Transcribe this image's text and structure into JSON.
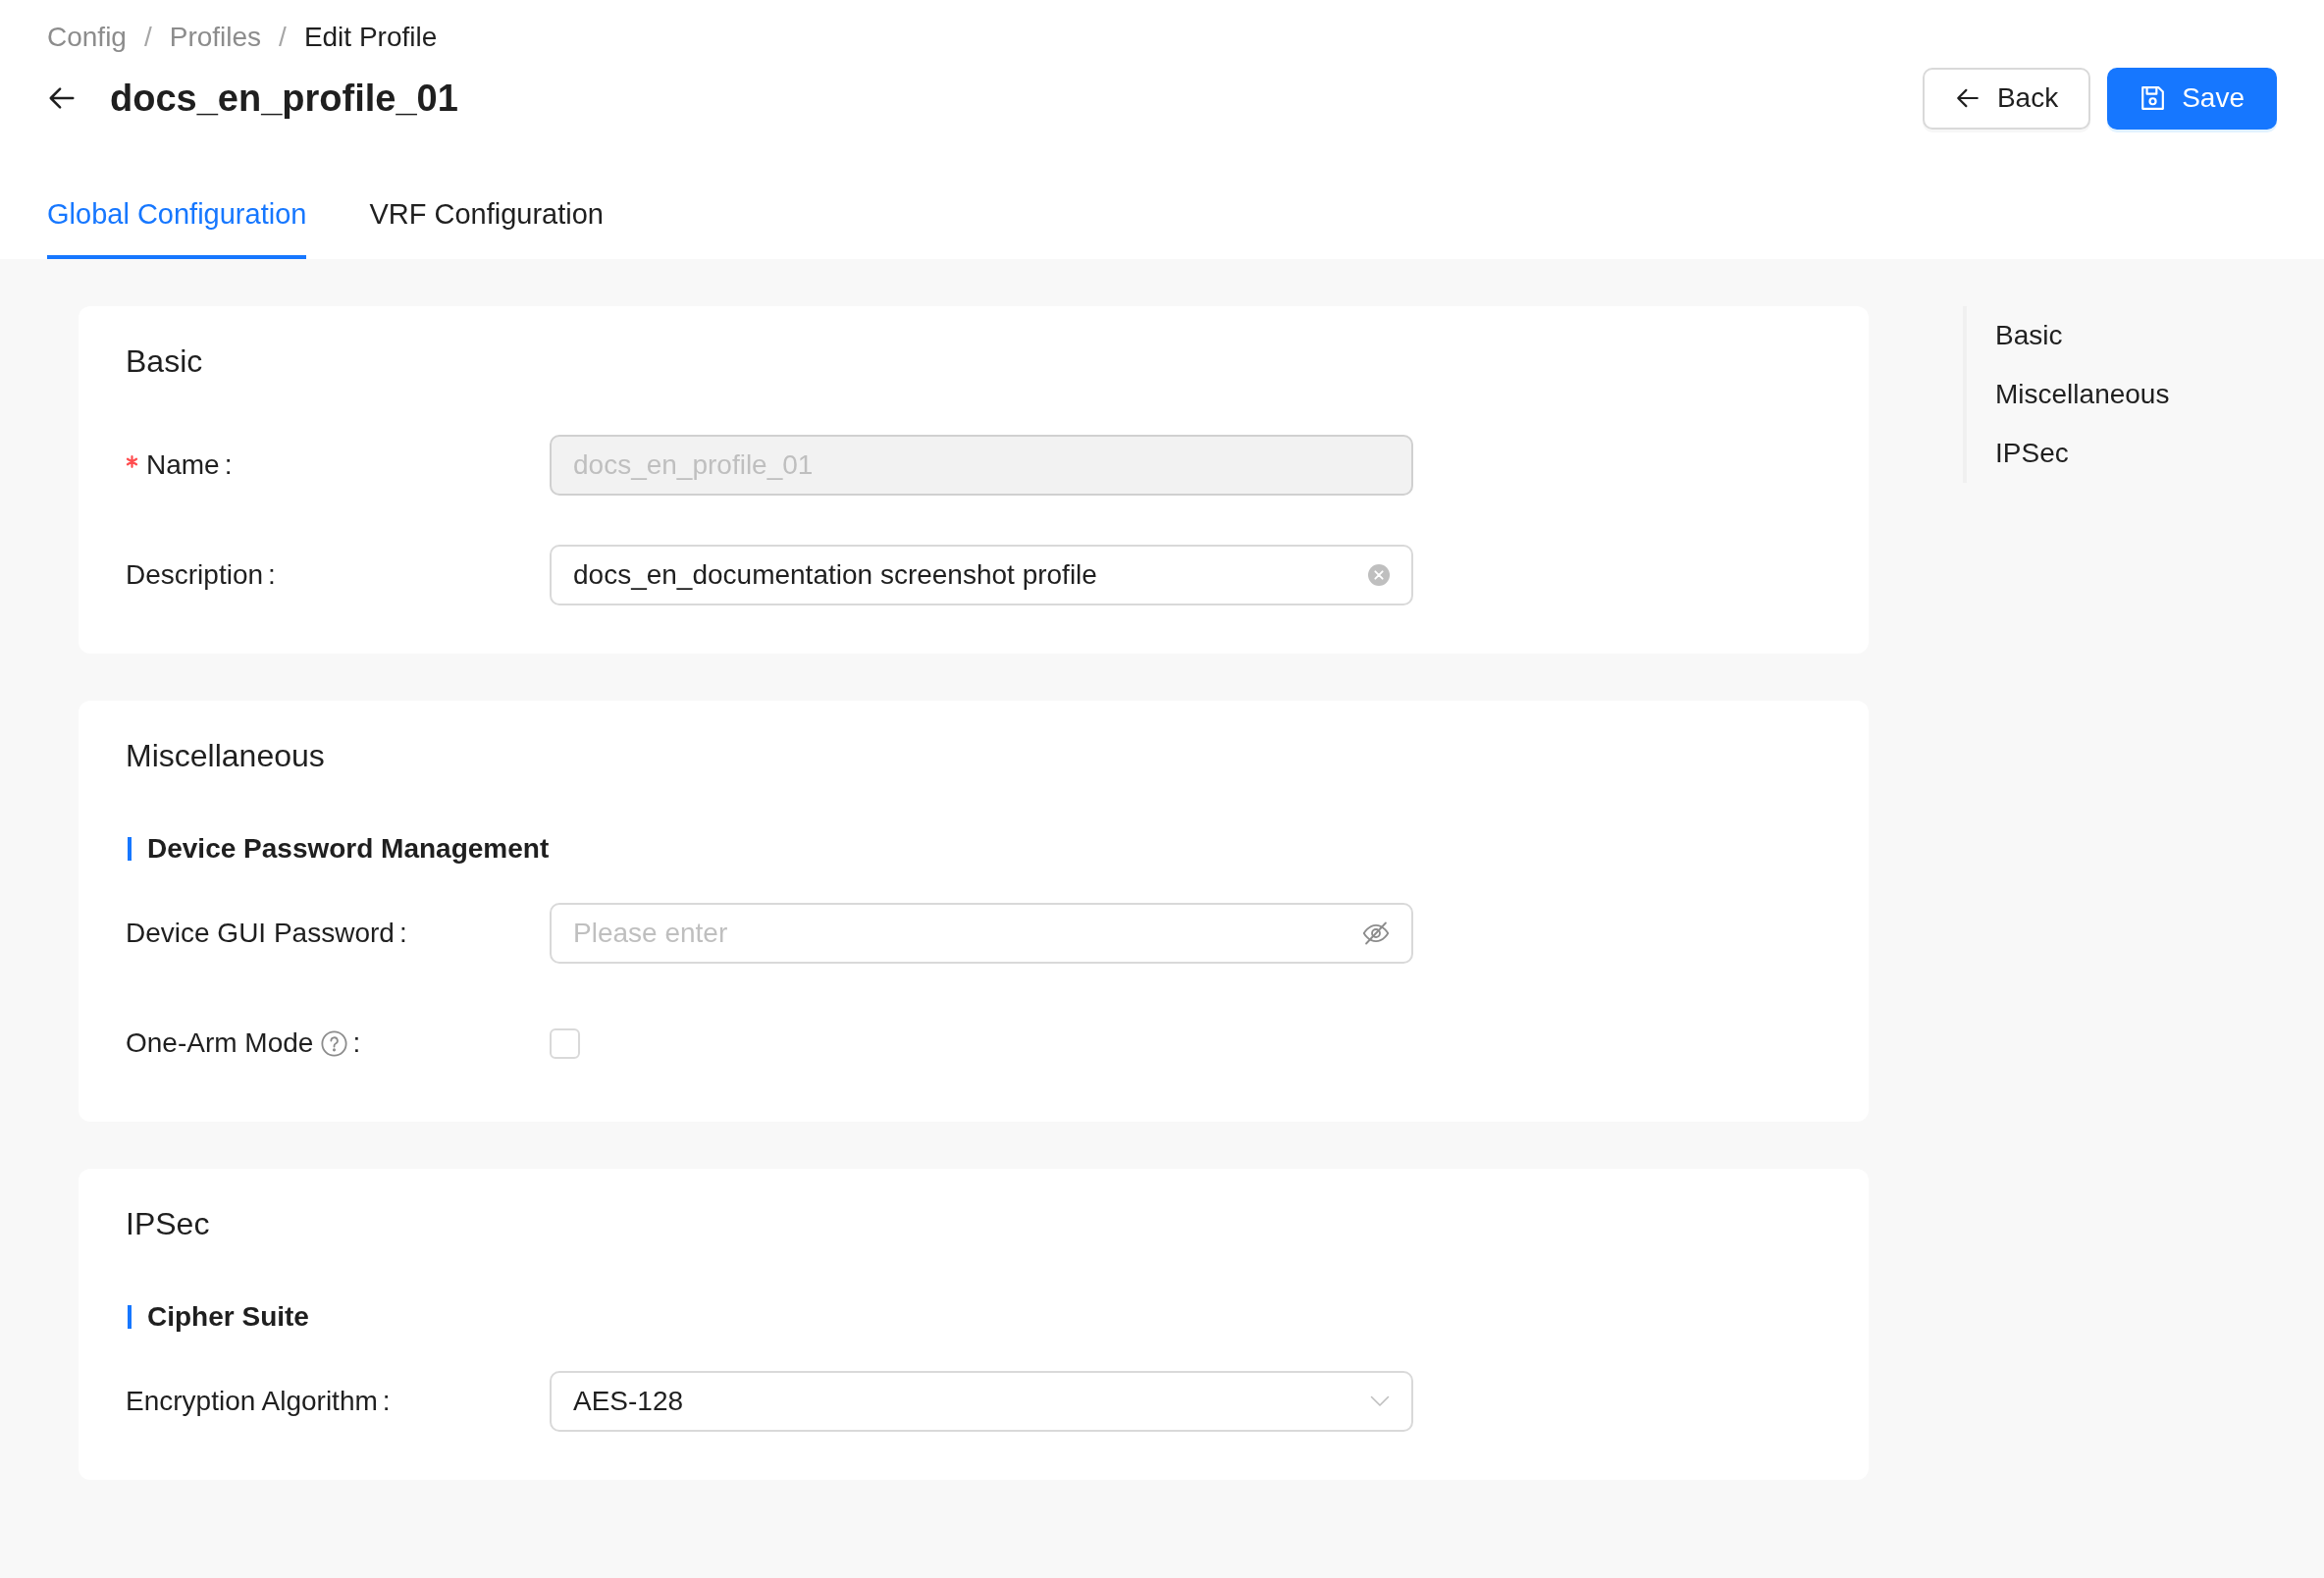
{
  "breadcrumb": {
    "separator": "/",
    "items": [
      {
        "label": "Config",
        "current": false
      },
      {
        "label": "Profiles",
        "current": false
      },
      {
        "label": "Edit Profile",
        "current": true
      }
    ]
  },
  "header": {
    "title": "docs_en_profile_01",
    "buttons": [
      {
        "label": "Back",
        "kind": "back"
      },
      {
        "label": "Save",
        "kind": "save"
      }
    ]
  },
  "tabs": [
    {
      "label": "Global Configuration",
      "selected": true
    },
    {
      "label": "VRF Configuration",
      "selected": false
    }
  ],
  "sections": [
    {
      "title": "Basic",
      "fields": [
        {
          "kind": "input",
          "label": "Name",
          "colon": ":",
          "required": true,
          "help": false,
          "disabled": true,
          "value": "docs_en_profile_01"
        },
        {
          "kind": "input",
          "label": "Description",
          "colon": ":",
          "required": false,
          "help": false,
          "disabled": false,
          "value": "docs_en_documentation screenshot profile"
        }
      ]
    },
    {
      "title": "Miscellaneous",
      "subtitle": "Device Password Management",
      "fields": [
        {
          "kind": "password",
          "label": "Device GUI Password",
          "colon": ":",
          "required": false,
          "help": false,
          "disabled": false,
          "placeholder": "Please enter"
        },
        {
          "kind": "checkbox",
          "label": "One-Arm Mode",
          "colon": ":",
          "required": false,
          "help": true,
          "disabled": false,
          "checked": false
        }
      ]
    },
    {
      "title": "IPSec",
      "subtitle": "Cipher Suite",
      "fields": [
        {
          "kind": "select",
          "label": "Encryption Algorithm",
          "colon": ":",
          "required": false,
          "help": false,
          "disabled": false,
          "value": "AES-128"
        }
      ]
    }
  ],
  "anchor": [
    {
      "label": "Basic",
      "selected": false
    },
    {
      "label": "Miscellaneous",
      "selected": false
    },
    {
      "label": "IPSec",
      "selected": false
    }
  ]
}
